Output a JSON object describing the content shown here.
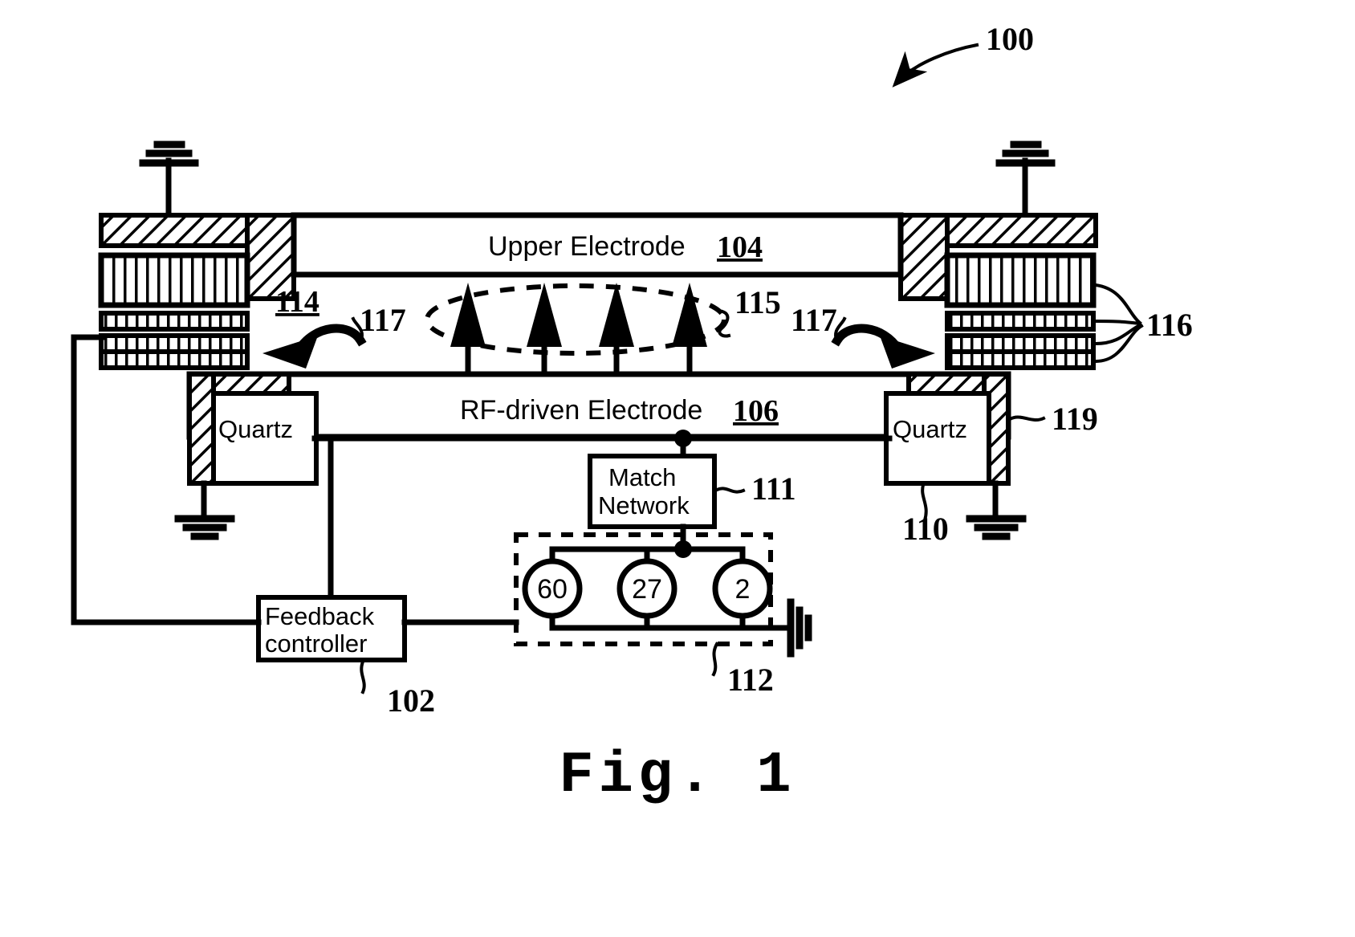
{
  "figure": {
    "caption": "Fig. 1",
    "system_ref": "100"
  },
  "electrodes": {
    "upper": {
      "label": "Upper Electrode",
      "ref": "104"
    },
    "rf_driven": {
      "label": "RF-driven Electrode",
      "ref": "106"
    }
  },
  "components": {
    "quartz_left": {
      "label": "Quartz"
    },
    "quartz_right": {
      "label": "Quartz",
      "ref": "110"
    },
    "match_network": {
      "label": "Match\nNetwork",
      "line1": "Match",
      "line2": "Network",
      "ref": "111"
    },
    "feedback_controller": {
      "label": "Feedback\ncontroller",
      "line1": "Feedback",
      "line2": "controller",
      "ref": "102"
    },
    "generator_bank": {
      "ref": "112"
    }
  },
  "generators": [
    {
      "label": "60"
    },
    {
      "label": "27"
    },
    {
      "label": "2"
    }
  ],
  "callouts": {
    "gap_ref": "114",
    "plasma_ref": "115",
    "coil_stack_ref": "116",
    "arrow_left_ref": "117",
    "arrow_right_ref": "117",
    "seal_ref": "119"
  },
  "colors": {
    "ink": "#000000",
    "paper": "#ffffff"
  },
  "icons": {
    "ground_top_left": "ground-icon",
    "ground_top_right": "ground-icon",
    "ground_quartz_left": "ground-icon",
    "ground_quartz_right": "ground-icon",
    "ground_generator": "ground-icon",
    "plasma_ellipse": "plasma-region-icon",
    "field_arrows": "field-arrow-icon",
    "curved_arrow_left": "curved-arrow-icon",
    "curved_arrow_right": "curved-arrow-icon",
    "pointer_100": "pointer-arrow-icon"
  }
}
